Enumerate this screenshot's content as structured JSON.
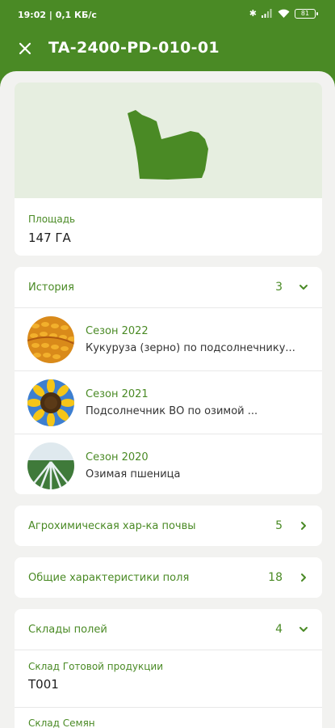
{
  "status_bar": {
    "time": "19:02 | 0,1 КБ/с",
    "battery": "81"
  },
  "header": {
    "title": "TA-2400-PD-010-01"
  },
  "colors": {
    "brand_green": "#4a8a25",
    "map_bg": "#e6eee0"
  },
  "area": {
    "label": "Площадь",
    "value": "147 ГА"
  },
  "history": {
    "label": "История",
    "count": "3",
    "items": [
      {
        "season": "Сезон 2022",
        "crop": "Кукуруза (зерно) по подсолнечнику...",
        "image": "corn-photo"
      },
      {
        "season": "Сезон 2021",
        "crop": "Подсолнечник ВО по озимой ...",
        "image": "sunflower-photo"
      },
      {
        "season": "Сезон 2020",
        "crop": "Озимая пшеница",
        "image": "wheat-field-photo"
      }
    ]
  },
  "agrochem": {
    "label": "Агрохимическая хар-ка почвы",
    "count": "5"
  },
  "general": {
    "label": "Общие характеристики поля",
    "count": "18"
  },
  "warehouses": {
    "label": "Склады полей",
    "count": "4",
    "items": [
      {
        "label": "Склад Готовой продукции",
        "value": "T001"
      },
      {
        "label": "Склад Семян",
        "value": ""
      }
    ]
  }
}
